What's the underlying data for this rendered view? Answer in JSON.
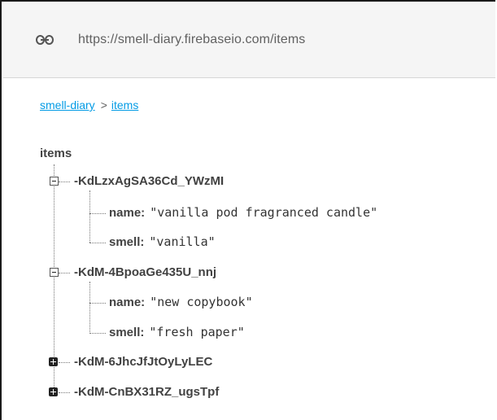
{
  "url": "https://smell-diary.firebaseio.com/items",
  "breadcrumb": {
    "root": "smell-diary",
    "separator": ">",
    "current": "items"
  },
  "tree": {
    "root_label": "items",
    "nodes": [
      {
        "key": "-KdLzxAgSA36Cd_YWzMI",
        "expanded": true,
        "children": [
          {
            "key": "name:",
            "value": "\"vanilla pod fragranced candle\""
          },
          {
            "key": "smell:",
            "value": "\"vanilla\""
          }
        ]
      },
      {
        "key": "-KdM-4BpoaGe435U_nnj",
        "expanded": true,
        "children": [
          {
            "key": "name:",
            "value": "\"new copybook\""
          },
          {
            "key": "smell:",
            "value": "\"fresh paper\""
          }
        ]
      },
      {
        "key": "-KdM-6JhcJfJtOyLyLEC",
        "expanded": false,
        "children": []
      },
      {
        "key": "-KdM-CnBX31RZ_ugsTpf",
        "expanded": false,
        "children": []
      }
    ]
  },
  "colors": {
    "link": "#039be5",
    "url_bar_bg": "#f5f5f5",
    "text": "#424242"
  }
}
